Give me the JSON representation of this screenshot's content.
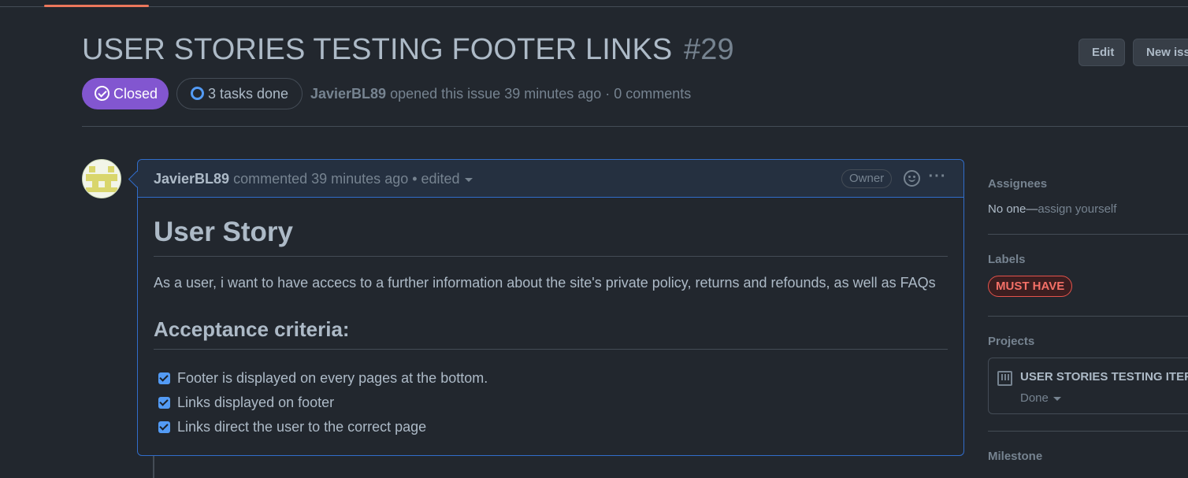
{
  "issue": {
    "title": "USER STORIES TESTING FOOTER LINKS",
    "number": "#29",
    "state": "Closed",
    "tasks_label": "3 tasks done",
    "author": "JavierBL89",
    "opened_text": "opened this issue 39 minutes ago · 0 comments"
  },
  "header_actions": {
    "edit_label": "Edit",
    "new_issue_label": "New issue"
  },
  "comment": {
    "author": "JavierBL89",
    "meta": "commented 39 minutes ago • edited",
    "role_badge": "Owner",
    "heading": "User Story",
    "paragraph": "As a user, i want to have accecs to a further information about the site's private policy, returns and refounds, as well as FAQs",
    "criteria_heading": "Acceptance criteria:",
    "tasks": [
      {
        "label": "Footer is displayed on every pages at the bottom.",
        "checked": true
      },
      {
        "label": "Links displayed on footer",
        "checked": true
      },
      {
        "label": "Links direct the user to the correct page",
        "checked": true
      }
    ]
  },
  "sidebar": {
    "assignees_heading": "Assignees",
    "assignees_value": "No one—",
    "assign_yourself": "assign yourself",
    "labels_heading": "Labels",
    "label": "MUST HAVE",
    "projects_heading": "Projects",
    "project_name": "USER STORIES TESTING ITERATION",
    "project_status": "Done",
    "milestone_heading": "Milestone"
  },
  "colors": {
    "background": "#22272e",
    "closed_state": "#8256d0",
    "accent_blue": "#539bf5",
    "label_red": "#f47067"
  }
}
